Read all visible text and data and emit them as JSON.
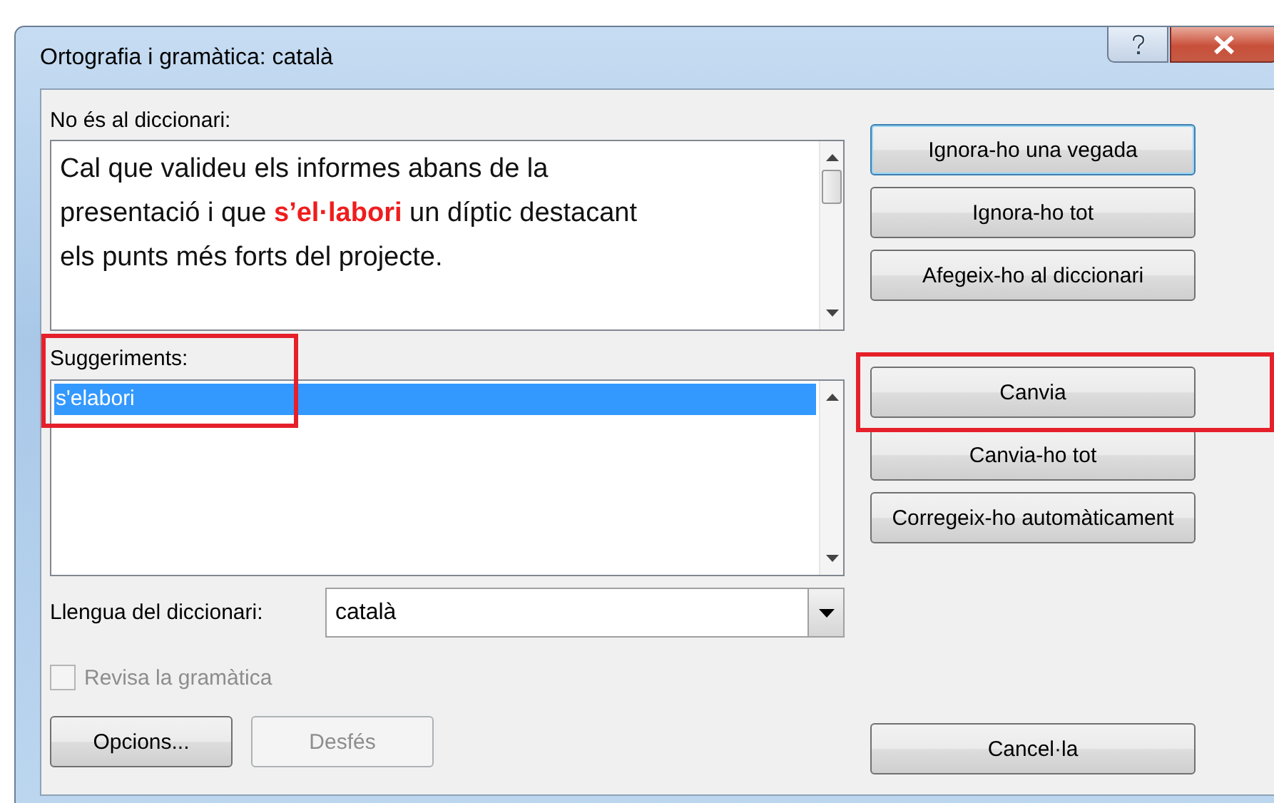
{
  "window": {
    "title": "Ortografia i gramàtica: català"
  },
  "not_in_dictionary": {
    "label": "No és al diccionari:",
    "text": "Cal que valideu els informes abans de la\npresentació i que **s’el·labori** un díptic destacant\nels punts més forts del projecte."
  },
  "suggestions": {
    "label": "Suggeriments:",
    "highlighted": true,
    "items": [
      {
        "text": "s'elabori",
        "selected": true
      }
    ]
  },
  "dictionary_language": {
    "label": "Llengua del diccionari:",
    "value": "català"
  },
  "grammar_check": {
    "label": "Revisa la gramàtica",
    "checked": false,
    "disabled": true
  },
  "button_groups": [
    [
      {
        "label": "Ignora-ho una vegada",
        "default": true,
        "highlighted": false
      },
      {
        "label": "Ignora-ho tot",
        "default": false,
        "highlighted": false
      },
      {
        "label": "Afegeix-ho al diccionari",
        "default": false,
        "highlighted": false
      }
    ],
    [
      {
        "label": "Canvia",
        "default": false,
        "highlighted": true
      },
      {
        "label": "Canvia-ho tot",
        "default": false,
        "highlighted": false
      },
      {
        "label": "Corregeix-ho automàticament",
        "default": false,
        "highlighted": false
      }
    ]
  ],
  "bottom_buttons": [
    {
      "label": "Opcions...",
      "disabled": false
    },
    {
      "label": "Desfés",
      "disabled": true
    }
  ],
  "cancel_button": {
    "label": "Cancel·la"
  }
}
